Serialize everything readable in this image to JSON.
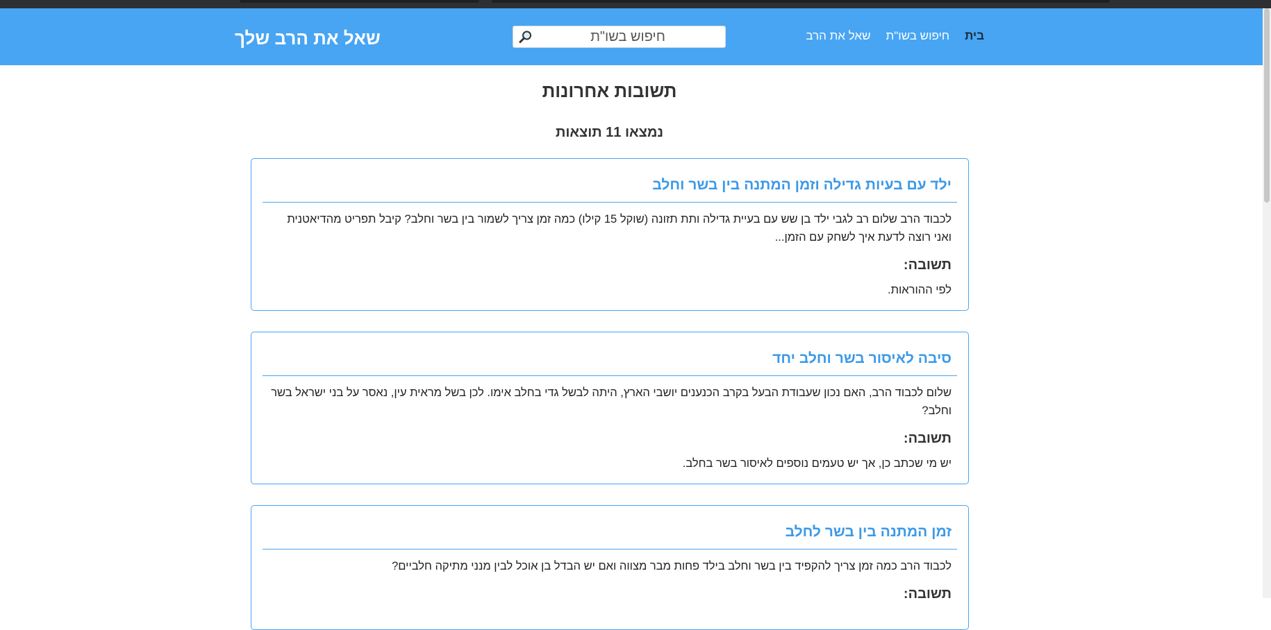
{
  "site": {
    "brand": "שאל את הרב שלך",
    "nav": [
      {
        "label": "בית",
        "active": true
      },
      {
        "label": "חיפוש בשו\"ת",
        "active": false
      },
      {
        "label": "שאל את הרב",
        "active": false
      }
    ],
    "search": {
      "placeholder": "חיפוש בשו\"ת",
      "value": ""
    },
    "accent_color": "#47a5f3"
  },
  "main": {
    "title": "תשובות אחרונות",
    "results_count": "נמצאו 11 תוצאות",
    "answer_label": "תשובה:",
    "cards": [
      {
        "title": "ילד עם בעיות גדילה וזמן המתנה בין בשר וחלב",
        "question": "לכבוד הרב שלום רב לגבי ילד בן שש עם בעיית גדילה ותת תזונה (שוקל 15 קילו) כמה זמן צריך לשמור בין בשר וחלב? קיבל תפריט מהדיאטנית ואני רוצה לדעת איך לשחק עם הזמן...",
        "answer": "לפי ההוראות."
      },
      {
        "title": "סיבה לאיסור בשר וחלב יחד",
        "question": "שלום לכבוד הרב, האם נכון שעבודת הבעל בקרב הכנענים יושבי הארץ, היתה לבשל גדי בחלב אימו. לכן בשל מראית עין, נאסר על בני ישראל בשר וחלב?",
        "answer": "יש מי שכתב כן, אך יש טעמים נוספים לאיסור בשר בחלב."
      },
      {
        "title": "זמן המתנה בין בשר לחלב",
        "question": "לכבוד הרב כמה זמן צריך להקפיד בין בשר וחלב בילד פחות מבר מצווה ואם יש הבדל בן אוכל לבין מנני מתיקה חלביים?",
        "answer": ""
      }
    ]
  }
}
